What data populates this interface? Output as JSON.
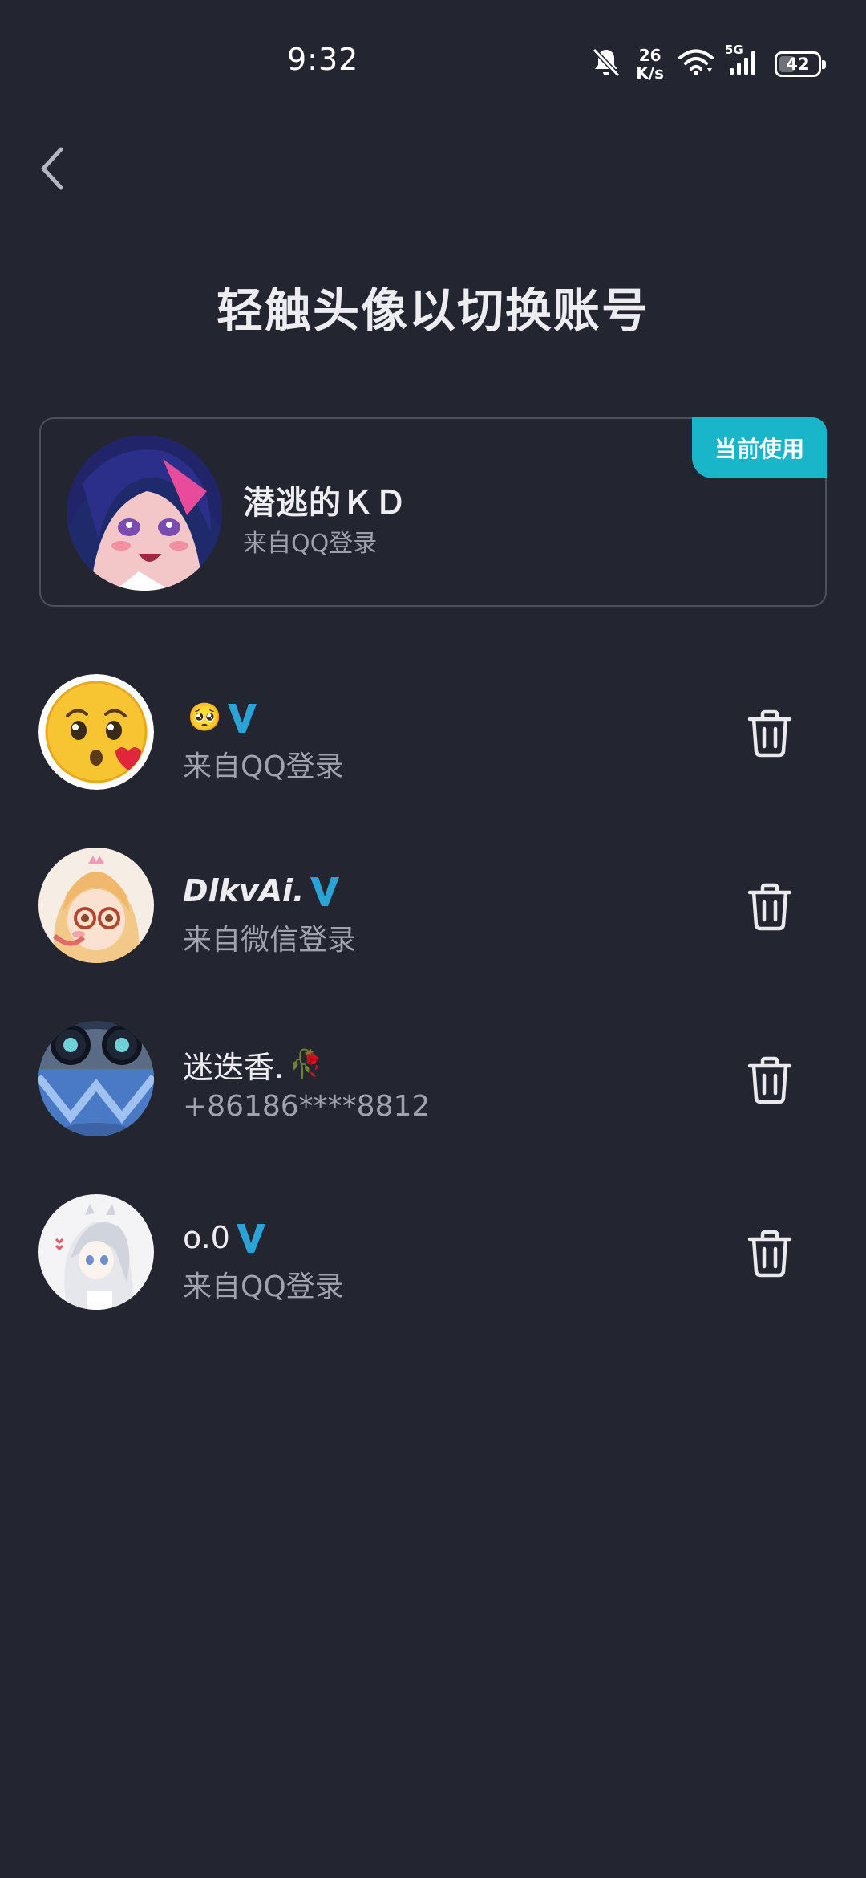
{
  "status_bar": {
    "time": "9:32",
    "net_speed_value": "26",
    "net_speed_unit": "K/s",
    "network_type": "5G",
    "battery_level": "42",
    "battery_fraction": 0.42,
    "icons": [
      "bell-off-icon",
      "wifi-icon",
      "signal-icon",
      "battery-icon"
    ]
  },
  "header": {
    "back_icon": "chevron-left-icon",
    "title": "轻触头像以切换账号"
  },
  "current_account": {
    "badge": "当前使用",
    "name": "潜逃的ＫＤ",
    "source": "来自QQ登录",
    "accent_color": "#19b6c9"
  },
  "accounts": [
    {
      "name": "",
      "emoji": "🥺",
      "vip": true,
      "source": "来自QQ登录",
      "avatar": "kissing-emoji-avatar"
    },
    {
      "name": "DlkvAi.",
      "vip": true,
      "source": "来自微信登录",
      "avatar": "anime-girl-glasses-avatar"
    },
    {
      "name": "迷迭香.",
      "emoji": "🥀",
      "vip": false,
      "source": "+86186****8812",
      "avatar": "blue-character-avatar"
    },
    {
      "name": "o.0",
      "vip": true,
      "source": "来自QQ登录",
      "avatar": "white-hair-girl-avatar"
    }
  ],
  "colors": {
    "background": "#232531",
    "vip_badge": "#2aa3d6",
    "secondary_text": "#a0a2ac"
  }
}
